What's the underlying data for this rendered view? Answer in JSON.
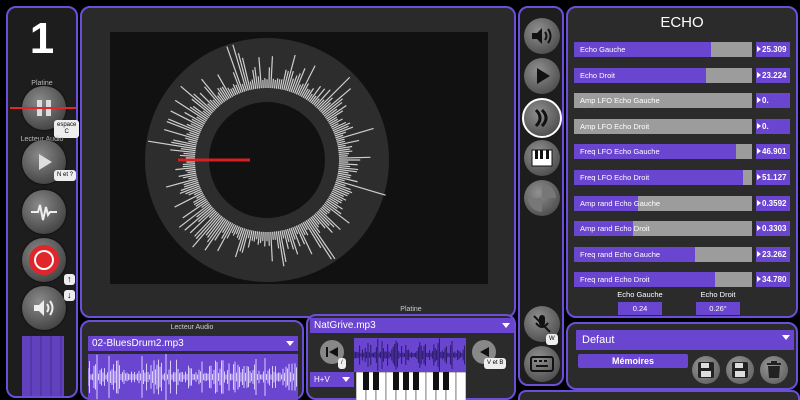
{
  "left": {
    "number": "1",
    "platine_label": "Platine",
    "lecteur_label": "Lecteur Audio",
    "key_pause": "espace\nC",
    "key_play": "N et ?",
    "up_arrow": "↑",
    "down_arrow": "↓"
  },
  "echo": {
    "title": "ECHO",
    "params": [
      {
        "label": "Echo Gauche",
        "value": "25.309",
        "fill": 0.77
      },
      {
        "label": "Echo Droit",
        "value": "23.224",
        "fill": 0.74
      },
      {
        "label": "Amp LFO Echo Gauche",
        "value": "0.",
        "fill": 0.0
      },
      {
        "label": "Amp LFO Echo Droit",
        "value": "0.",
        "fill": 0.0
      },
      {
        "label": "Freq LFO Echo Gauche",
        "value": "46.901",
        "fill": 0.91
      },
      {
        "label": "Freq LFO Echo Droit",
        "value": "51.127",
        "fill": 0.95
      },
      {
        "label": "Amp rand Echo Gauche",
        "value": "0.3592",
        "fill": 0.36
      },
      {
        "label": "Amp rand Echo Droit",
        "value": "0.3303",
        "fill": 0.33
      },
      {
        "label": "Freq rand Echo Gauche",
        "value": "23.262",
        "fill": 0.68
      },
      {
        "label": "Freq rand Echo Droit",
        "value": "34.780",
        "fill": 0.79
      }
    ],
    "mini": [
      {
        "label": "Echo Gauche",
        "value": "0.24"
      },
      {
        "label": "Echo Droit",
        "value": "0.26°"
      }
    ]
  },
  "memory": {
    "preset": "Defaut",
    "button": "Mémoires"
  },
  "lecteur": {
    "title": "Lecteur Audio",
    "file": "02-BluesDrum2.mp3"
  },
  "platine": {
    "title": "Platine",
    "file": "NatGrive.mp3",
    "key_left": "/",
    "key_right": "V et B",
    "mode": "H+V"
  },
  "tools": {
    "key_w": "W"
  },
  "colors": {
    "accent": "#6a45d0",
    "border": "#6b4fd8",
    "record": "#e0262b"
  }
}
